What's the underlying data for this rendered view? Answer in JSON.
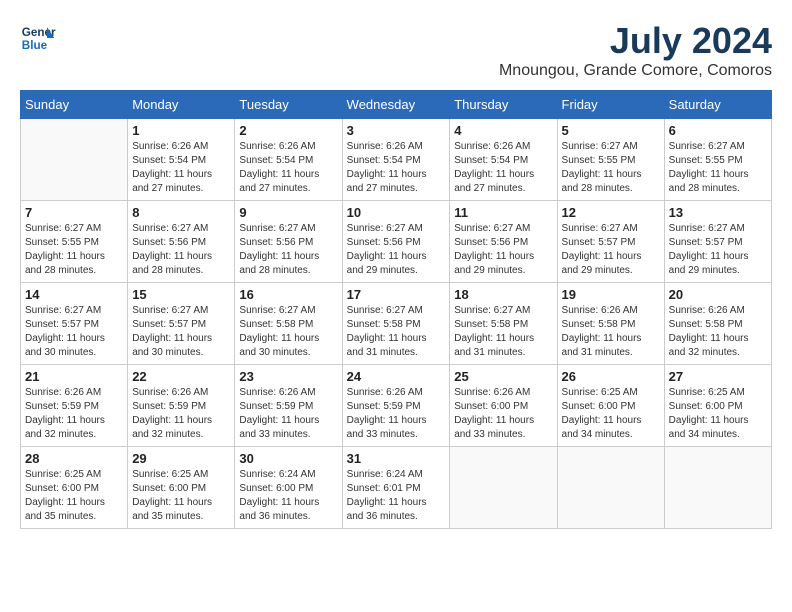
{
  "logo": {
    "line1": "General",
    "line2": "Blue"
  },
  "title": "July 2024",
  "location": "Mnoungou, Grande Comore, Comoros",
  "weekdays": [
    "Sunday",
    "Monday",
    "Tuesday",
    "Wednesday",
    "Thursday",
    "Friday",
    "Saturday"
  ],
  "weeks": [
    [
      {
        "day": "",
        "info": ""
      },
      {
        "day": "1",
        "info": "Sunrise: 6:26 AM\nSunset: 5:54 PM\nDaylight: 11 hours\nand 27 minutes."
      },
      {
        "day": "2",
        "info": "Sunrise: 6:26 AM\nSunset: 5:54 PM\nDaylight: 11 hours\nand 27 minutes."
      },
      {
        "day": "3",
        "info": "Sunrise: 6:26 AM\nSunset: 5:54 PM\nDaylight: 11 hours\nand 27 minutes."
      },
      {
        "day": "4",
        "info": "Sunrise: 6:26 AM\nSunset: 5:54 PM\nDaylight: 11 hours\nand 27 minutes."
      },
      {
        "day": "5",
        "info": "Sunrise: 6:27 AM\nSunset: 5:55 PM\nDaylight: 11 hours\nand 28 minutes."
      },
      {
        "day": "6",
        "info": "Sunrise: 6:27 AM\nSunset: 5:55 PM\nDaylight: 11 hours\nand 28 minutes."
      }
    ],
    [
      {
        "day": "7",
        "info": "Sunrise: 6:27 AM\nSunset: 5:55 PM\nDaylight: 11 hours\nand 28 minutes."
      },
      {
        "day": "8",
        "info": "Sunrise: 6:27 AM\nSunset: 5:56 PM\nDaylight: 11 hours\nand 28 minutes."
      },
      {
        "day": "9",
        "info": "Sunrise: 6:27 AM\nSunset: 5:56 PM\nDaylight: 11 hours\nand 28 minutes."
      },
      {
        "day": "10",
        "info": "Sunrise: 6:27 AM\nSunset: 5:56 PM\nDaylight: 11 hours\nand 29 minutes."
      },
      {
        "day": "11",
        "info": "Sunrise: 6:27 AM\nSunset: 5:56 PM\nDaylight: 11 hours\nand 29 minutes."
      },
      {
        "day": "12",
        "info": "Sunrise: 6:27 AM\nSunset: 5:57 PM\nDaylight: 11 hours\nand 29 minutes."
      },
      {
        "day": "13",
        "info": "Sunrise: 6:27 AM\nSunset: 5:57 PM\nDaylight: 11 hours\nand 29 minutes."
      }
    ],
    [
      {
        "day": "14",
        "info": "Sunrise: 6:27 AM\nSunset: 5:57 PM\nDaylight: 11 hours\nand 30 minutes."
      },
      {
        "day": "15",
        "info": "Sunrise: 6:27 AM\nSunset: 5:57 PM\nDaylight: 11 hours\nand 30 minutes."
      },
      {
        "day": "16",
        "info": "Sunrise: 6:27 AM\nSunset: 5:58 PM\nDaylight: 11 hours\nand 30 minutes."
      },
      {
        "day": "17",
        "info": "Sunrise: 6:27 AM\nSunset: 5:58 PM\nDaylight: 11 hours\nand 31 minutes."
      },
      {
        "day": "18",
        "info": "Sunrise: 6:27 AM\nSunset: 5:58 PM\nDaylight: 11 hours\nand 31 minutes."
      },
      {
        "day": "19",
        "info": "Sunrise: 6:26 AM\nSunset: 5:58 PM\nDaylight: 11 hours\nand 31 minutes."
      },
      {
        "day": "20",
        "info": "Sunrise: 6:26 AM\nSunset: 5:58 PM\nDaylight: 11 hours\nand 32 minutes."
      }
    ],
    [
      {
        "day": "21",
        "info": "Sunrise: 6:26 AM\nSunset: 5:59 PM\nDaylight: 11 hours\nand 32 minutes."
      },
      {
        "day": "22",
        "info": "Sunrise: 6:26 AM\nSunset: 5:59 PM\nDaylight: 11 hours\nand 32 minutes."
      },
      {
        "day": "23",
        "info": "Sunrise: 6:26 AM\nSunset: 5:59 PM\nDaylight: 11 hours\nand 33 minutes."
      },
      {
        "day": "24",
        "info": "Sunrise: 6:26 AM\nSunset: 5:59 PM\nDaylight: 11 hours\nand 33 minutes."
      },
      {
        "day": "25",
        "info": "Sunrise: 6:26 AM\nSunset: 6:00 PM\nDaylight: 11 hours\nand 33 minutes."
      },
      {
        "day": "26",
        "info": "Sunrise: 6:25 AM\nSunset: 6:00 PM\nDaylight: 11 hours\nand 34 minutes."
      },
      {
        "day": "27",
        "info": "Sunrise: 6:25 AM\nSunset: 6:00 PM\nDaylight: 11 hours\nand 34 minutes."
      }
    ],
    [
      {
        "day": "28",
        "info": "Sunrise: 6:25 AM\nSunset: 6:00 PM\nDaylight: 11 hours\nand 35 minutes."
      },
      {
        "day": "29",
        "info": "Sunrise: 6:25 AM\nSunset: 6:00 PM\nDaylight: 11 hours\nand 35 minutes."
      },
      {
        "day": "30",
        "info": "Sunrise: 6:24 AM\nSunset: 6:00 PM\nDaylight: 11 hours\nand 36 minutes."
      },
      {
        "day": "31",
        "info": "Sunrise: 6:24 AM\nSunset: 6:01 PM\nDaylight: 11 hours\nand 36 minutes."
      },
      {
        "day": "",
        "info": ""
      },
      {
        "day": "",
        "info": ""
      },
      {
        "day": "",
        "info": ""
      }
    ]
  ]
}
